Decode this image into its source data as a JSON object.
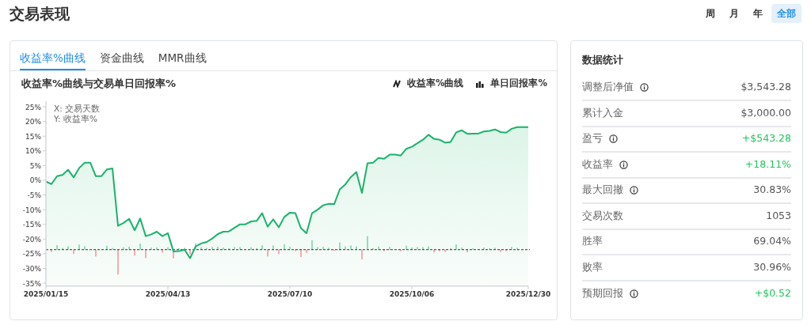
{
  "page_title": "交易表现",
  "periods": [
    {
      "label": "周",
      "selected": false
    },
    {
      "label": "月",
      "selected": false
    },
    {
      "label": "年",
      "selected": false
    },
    {
      "label": "全部",
      "selected": true
    }
  ],
  "tabs": [
    {
      "label": "收益率%曲线",
      "selected": true
    },
    {
      "label": "资金曲线",
      "selected": false
    },
    {
      "label": "MMR曲线",
      "selected": false
    }
  ],
  "chart_panel": {
    "title": "收益率%曲线与交易单日回报率%",
    "legend": [
      {
        "kind": "line"
      },
      {
        "kind": "bar",
        "label": "单日回报率%"
      }
    ],
    "chart_data": {
      "type": "line",
      "ylim": [
        -36,
        27
      ],
      "categories": [
        "2025/01/15",
        null,
        null,
        null,
        null,
        null,
        null,
        null,
        null,
        null,
        null,
        null,
        null,
        null,
        null,
        null,
        null,
        null,
        null,
        null,
        null,
        null,
        "2025/04/13",
        null,
        null,
        null,
        null,
        null,
        null,
        null,
        null,
        null,
        null,
        null,
        null,
        null,
        null,
        null,
        null,
        null,
        null,
        null,
        null,
        null,
        "2025/07/10",
        null,
        null,
        null,
        null,
        null,
        null,
        null,
        null,
        null,
        null,
        null,
        null,
        null,
        null,
        null,
        null,
        null,
        null,
        null,
        null,
        null,
        "2025/10/06",
        null,
        null,
        null,
        null,
        null,
        null,
        null,
        null,
        null,
        null,
        null,
        null,
        null,
        null,
        null,
        null,
        null,
        null,
        null,
        null,
        "2025/12/30"
      ],
      "yticks": [
        {
          "value": 25,
          "label": "25%"
        },
        {
          "value": 20,
          "label": "20%"
        },
        {
          "value": 15,
          "label": "15%"
        },
        {
          "value": 10,
          "label": "10%"
        },
        {
          "value": 5,
          "label": "5%"
        },
        {
          "value": 0,
          "label": "0%"
        },
        {
          "value": -5,
          "label": "-5%"
        },
        {
          "value": -10,
          "label": "-10%"
        },
        {
          "value": -15,
          "label": "-15%"
        },
        {
          "value": -20,
          "label": "-20%"
        },
        {
          "value": -25,
          "label": "-25%"
        },
        {
          "value": -30,
          "label": "-30%"
        },
        {
          "value": -35,
          "label": "-35%"
        }
      ],
      "annotations": [
        "X: 交易天数",
        "Y: 收益率%"
      ],
      "series": [
        {
          "name": "收益率%曲线",
          "color": "#19b36b",
          "values": [
            -0.4,
            -1.3,
            1.4,
            1.8,
            3.6,
            1.0,
            4.2,
            6,
            6,
            1.4,
            1.4,
            3.7,
            4,
            -15.5,
            -14.5,
            -13.1,
            -17,
            -13,
            -19,
            -18.4,
            -17.5,
            -19,
            -18,
            -24.2,
            -24.1,
            -23.6,
            -26.5,
            -22.5,
            -21.5,
            -21,
            -19.8,
            -18.3,
            -17.5,
            -17.4,
            -16.2,
            -15,
            -15,
            -14,
            -13.8,
            -11.2,
            -15.8,
            -13.3,
            -16,
            -12.5,
            -11,
            -11.2,
            -16.3,
            -18,
            -11.2,
            -10,
            -8.5,
            -8,
            -8.1,
            -3.1,
            -1.4,
            1.1,
            2.8,
            -4.3,
            5.8,
            6,
            7.6,
            7.3,
            8.7,
            8.7,
            8.4,
            10.7,
            11.4,
            12.6,
            13.8,
            15.5,
            14.1,
            13.8,
            12.8,
            13,
            16.3,
            17,
            15.8,
            15.9,
            15.9,
            16.6,
            16.8,
            17.3,
            16.4,
            16.2,
            17.5,
            18.1,
            18.1,
            18.1
          ]
        }
      ]
    }
  },
  "stats": {
    "title": "数据统计",
    "rows": [
      {
        "label": "调整后净值",
        "info": true,
        "value": "$3,543.28"
      },
      {
        "label": "累计入金",
        "info": false,
        "value": "$3,000.00"
      },
      {
        "label": "盈亏",
        "info": true,
        "value": "+$543.28",
        "color": "#22c55e"
      },
      {
        "label": "收益率",
        "info": true,
        "value": "+18.11%",
        "color": "#22c55e"
      },
      {
        "label": "最大回撤",
        "info": true,
        "value": "30.83%"
      },
      {
        "label": "交易次数",
        "info": false,
        "value": "1053"
      },
      {
        "label": "胜率",
        "info": false,
        "value": "69.04%"
      },
      {
        "label": "败率",
        "info": false,
        "value": "30.96%"
      },
      {
        "label": "预期回报",
        "info": true,
        "value": "+$0.52",
        "color": "#22c55e"
      }
    ]
  }
}
